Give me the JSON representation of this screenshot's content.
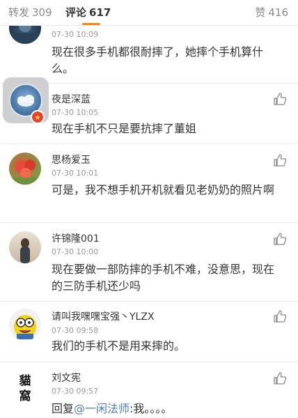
{
  "tabs": {
    "reposts": {
      "label": "转发",
      "count": "309"
    },
    "comments": {
      "label": "评论",
      "count": "617"
    },
    "likes": {
      "label": "赞",
      "count": "416"
    }
  },
  "comments": [
    {
      "username": "",
      "time": "07-30 10:09",
      "text": "现在很多手机都很耐摔了，她摔个手机算什么。"
    },
    {
      "username": "夜是深蓝",
      "time": "07-30 10:05",
      "text": "现在手机不只是要抗摔了董姐"
    },
    {
      "username": "思杨爱玉",
      "time": "07-30 10:01",
      "text": "可是，我不想手机开机就看见老奶奶的照片啊"
    },
    {
      "username": "许锦隆001",
      "time": "07-30 10:00",
      "text": "现在要做一部防摔的手机不难，没意思，现在的三防手机还少吗"
    },
    {
      "username": "请叫我嘿嘿宝强丶YLZX",
      "time": "07-30 09:58",
      "text": "我们的手机不是用来摔的。"
    },
    {
      "username": "刘文宪",
      "time": "07-30 09:57",
      "text_prefix": "回复",
      "mention": "@一闲法师",
      "text_suffix": ":我。。。。"
    }
  ],
  "avatar_logo_text": "貓窩",
  "colors": {
    "accent": "#ff8200",
    "mention": "#507daf",
    "time": "#999999"
  }
}
